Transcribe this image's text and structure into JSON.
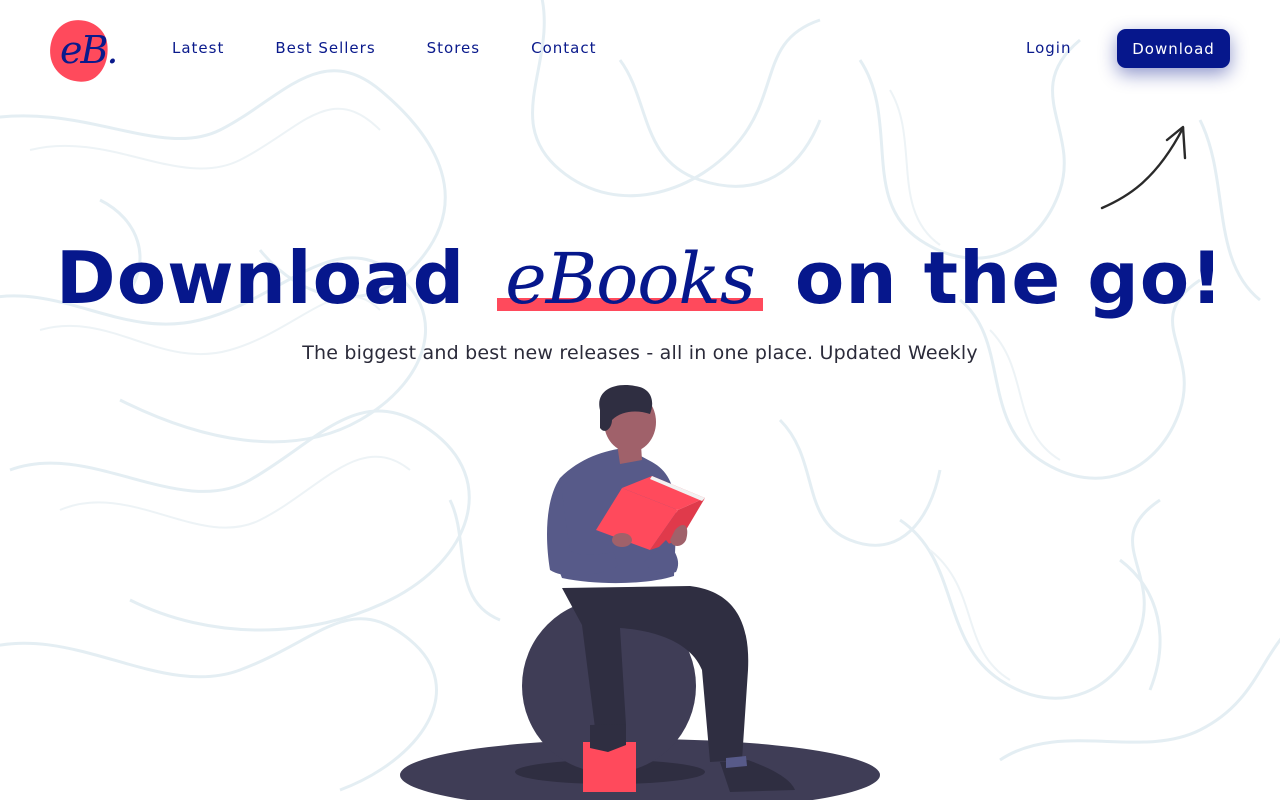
{
  "brand": {
    "logo_text": "eB.",
    "accent_color": "#ff4a5c",
    "primary_color": "#06178c"
  },
  "nav": {
    "links": [
      "Latest",
      "Best Sellers",
      "Stores",
      "Contact"
    ],
    "login_label": "Login",
    "download_label": "Download"
  },
  "hero": {
    "title_before": "Download",
    "title_accent": "eBooks",
    "title_after": "on the go!",
    "subtitle": "The biggest and best new releases - all in one place. Updated Weekly"
  },
  "icons": {
    "arrow": "hand-drawn-arrow-icon",
    "illustration": "person-reading-book-illustration"
  }
}
